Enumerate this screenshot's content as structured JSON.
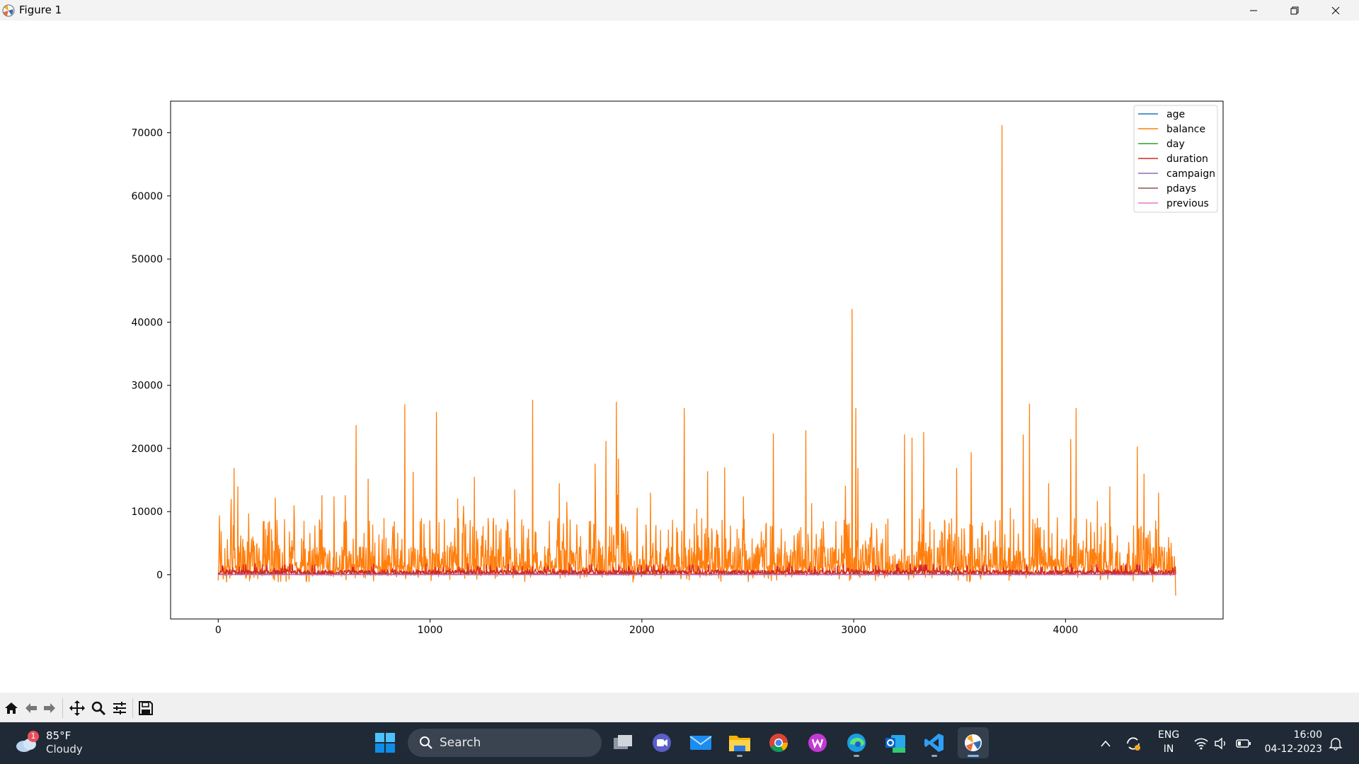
{
  "window": {
    "title": "Figure 1"
  },
  "toolbar": {
    "tools": [
      "home-icon",
      "back-arrow-icon",
      "forward-arrow-icon",
      "pan-icon",
      "zoom-icon",
      "configure-subplots-icon",
      "save-icon"
    ]
  },
  "chart_data": {
    "type": "line",
    "title": "",
    "xlabel": "",
    "ylabel": "",
    "xlim": [
      -225,
      4744
    ],
    "ylim": [
      -7000,
      75000
    ],
    "x_ticks": [
      0,
      1000,
      2000,
      3000,
      4000
    ],
    "y_ticks": [
      0,
      10000,
      20000,
      30000,
      40000,
      50000,
      60000,
      70000
    ],
    "x_tick_labels": [
      "0",
      "1000",
      "2000",
      "3000",
      "4000"
    ],
    "y_tick_labels": [
      "0",
      "10000",
      "20000",
      "30000",
      "40000",
      "50000",
      "60000",
      "70000"
    ],
    "grid": false,
    "legend_position": "top-right",
    "x_range": [
      0,
      4520
    ],
    "series": [
      {
        "name": "age",
        "color": "#1f77b4",
        "typical": 41,
        "min": 19,
        "max": 87
      },
      {
        "name": "balance",
        "color": "#ff7f0e",
        "typical": 1400,
        "min": -3300,
        "max": 71200,
        "peaks": [
          {
            "x": 5,
            "y": 9400
          },
          {
            "x": 60,
            "y": 12000
          },
          {
            "x": 75,
            "y": 16900
          },
          {
            "x": 92,
            "y": 14000
          },
          {
            "x": 270,
            "y": 12200
          },
          {
            "x": 358,
            "y": 11000
          },
          {
            "x": 490,
            "y": 12600
          },
          {
            "x": 547,
            "y": 12400
          },
          {
            "x": 600,
            "y": 12600
          },
          {
            "x": 650,
            "y": 23700
          },
          {
            "x": 707,
            "y": 15200
          },
          {
            "x": 880,
            "y": 27000
          },
          {
            "x": 920,
            "y": 16300
          },
          {
            "x": 1030,
            "y": 25800
          },
          {
            "x": 1210,
            "y": 15500
          },
          {
            "x": 1400,
            "y": 13500
          },
          {
            "x": 1485,
            "y": 27700
          },
          {
            "x": 1610,
            "y": 14500
          },
          {
            "x": 1780,
            "y": 17600
          },
          {
            "x": 1830,
            "y": 21200
          },
          {
            "x": 1880,
            "y": 27400
          },
          {
            "x": 1890,
            "y": 18400
          },
          {
            "x": 2040,
            "y": 13000
          },
          {
            "x": 2200,
            "y": 26400
          },
          {
            "x": 2310,
            "y": 16400
          },
          {
            "x": 2390,
            "y": 17000
          },
          {
            "x": 2620,
            "y": 22400
          },
          {
            "x": 2775,
            "y": 22900
          },
          {
            "x": 2960,
            "y": 14100
          },
          {
            "x": 2993,
            "y": 42100
          },
          {
            "x": 3010,
            "y": 26400
          },
          {
            "x": 3020,
            "y": 16900
          },
          {
            "x": 3240,
            "y": 22200
          },
          {
            "x": 3275,
            "y": 21700
          },
          {
            "x": 3330,
            "y": 22600
          },
          {
            "x": 3485,
            "y": 16900
          },
          {
            "x": 3555,
            "y": 19400
          },
          {
            "x": 3700,
            "y": 71200
          },
          {
            "x": 3800,
            "y": 22200
          },
          {
            "x": 3830,
            "y": 27100
          },
          {
            "x": 3920,
            "y": 14500
          },
          {
            "x": 4025,
            "y": 21500
          },
          {
            "x": 4050,
            "y": 26400
          },
          {
            "x": 4210,
            "y": 14000
          },
          {
            "x": 4340,
            "y": 20300
          },
          {
            "x": 4370,
            "y": 16000
          },
          {
            "x": 4440,
            "y": 13000
          },
          {
            "x": 4520,
            "y": -3300
          }
        ]
      },
      {
        "name": "day",
        "color": "#2ca02c",
        "typical": 16,
        "min": 1,
        "max": 31
      },
      {
        "name": "duration",
        "color": "#d62728",
        "typical": 260,
        "min": 4,
        "max": 3000
      },
      {
        "name": "campaign",
        "color": "#9467bd",
        "typical": 3,
        "min": 1,
        "max": 50
      },
      {
        "name": "pdays",
        "color": "#8c564b",
        "typical": 40,
        "min": -1,
        "max": 871
      },
      {
        "name": "previous",
        "color": "#e377c2",
        "typical": 1,
        "min": 0,
        "max": 25
      }
    ]
  },
  "taskbar": {
    "weather": {
      "temp": "85°F",
      "condition": "Cloudy",
      "badge": "1"
    },
    "search_label": "Search",
    "apps": [
      "task-view-icon",
      "teams-icon",
      "mail-icon",
      "file-explorer-icon",
      "chrome-icon",
      "wps-office-icon",
      "edge-icon",
      "outlook-new-icon",
      "vscode-icon",
      "matplotlib-figure-icon"
    ],
    "lang": {
      "line1": "ENG",
      "line2": "IN"
    },
    "clock": {
      "time": "16:00",
      "date": "04-12-2023"
    }
  }
}
